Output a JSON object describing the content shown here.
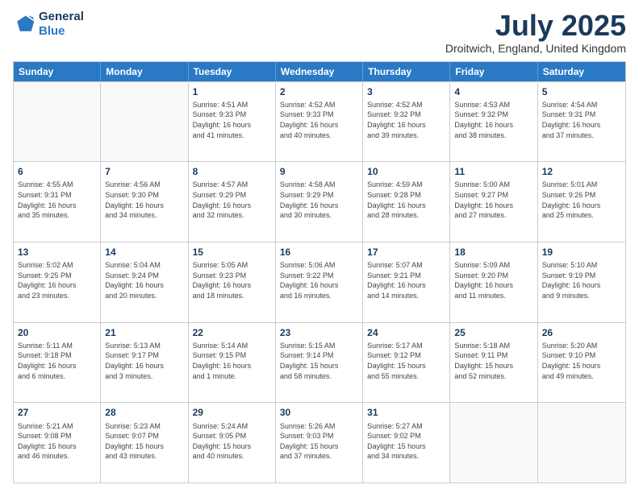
{
  "header": {
    "logo_line1": "General",
    "logo_line2": "Blue",
    "month_title": "July 2025",
    "location": "Droitwich, England, United Kingdom"
  },
  "days_of_week": [
    "Sunday",
    "Monday",
    "Tuesday",
    "Wednesday",
    "Thursday",
    "Friday",
    "Saturday"
  ],
  "weeks": [
    [
      {
        "day": "",
        "info": ""
      },
      {
        "day": "",
        "info": ""
      },
      {
        "day": "1",
        "info": "Sunrise: 4:51 AM\nSunset: 9:33 PM\nDaylight: 16 hours\nand 41 minutes."
      },
      {
        "day": "2",
        "info": "Sunrise: 4:52 AM\nSunset: 9:33 PM\nDaylight: 16 hours\nand 40 minutes."
      },
      {
        "day": "3",
        "info": "Sunrise: 4:52 AM\nSunset: 9:32 PM\nDaylight: 16 hours\nand 39 minutes."
      },
      {
        "day": "4",
        "info": "Sunrise: 4:53 AM\nSunset: 9:32 PM\nDaylight: 16 hours\nand 38 minutes."
      },
      {
        "day": "5",
        "info": "Sunrise: 4:54 AM\nSunset: 9:31 PM\nDaylight: 16 hours\nand 37 minutes."
      }
    ],
    [
      {
        "day": "6",
        "info": "Sunrise: 4:55 AM\nSunset: 9:31 PM\nDaylight: 16 hours\nand 35 minutes."
      },
      {
        "day": "7",
        "info": "Sunrise: 4:56 AM\nSunset: 9:30 PM\nDaylight: 16 hours\nand 34 minutes."
      },
      {
        "day": "8",
        "info": "Sunrise: 4:57 AM\nSunset: 9:29 PM\nDaylight: 16 hours\nand 32 minutes."
      },
      {
        "day": "9",
        "info": "Sunrise: 4:58 AM\nSunset: 9:29 PM\nDaylight: 16 hours\nand 30 minutes."
      },
      {
        "day": "10",
        "info": "Sunrise: 4:59 AM\nSunset: 9:28 PM\nDaylight: 16 hours\nand 28 minutes."
      },
      {
        "day": "11",
        "info": "Sunrise: 5:00 AM\nSunset: 9:27 PM\nDaylight: 16 hours\nand 27 minutes."
      },
      {
        "day": "12",
        "info": "Sunrise: 5:01 AM\nSunset: 9:26 PM\nDaylight: 16 hours\nand 25 minutes."
      }
    ],
    [
      {
        "day": "13",
        "info": "Sunrise: 5:02 AM\nSunset: 9:25 PM\nDaylight: 16 hours\nand 23 minutes."
      },
      {
        "day": "14",
        "info": "Sunrise: 5:04 AM\nSunset: 9:24 PM\nDaylight: 16 hours\nand 20 minutes."
      },
      {
        "day": "15",
        "info": "Sunrise: 5:05 AM\nSunset: 9:23 PM\nDaylight: 16 hours\nand 18 minutes."
      },
      {
        "day": "16",
        "info": "Sunrise: 5:06 AM\nSunset: 9:22 PM\nDaylight: 16 hours\nand 16 minutes."
      },
      {
        "day": "17",
        "info": "Sunrise: 5:07 AM\nSunset: 9:21 PM\nDaylight: 16 hours\nand 14 minutes."
      },
      {
        "day": "18",
        "info": "Sunrise: 5:09 AM\nSunset: 9:20 PM\nDaylight: 16 hours\nand 11 minutes."
      },
      {
        "day": "19",
        "info": "Sunrise: 5:10 AM\nSunset: 9:19 PM\nDaylight: 16 hours\nand 9 minutes."
      }
    ],
    [
      {
        "day": "20",
        "info": "Sunrise: 5:11 AM\nSunset: 9:18 PM\nDaylight: 16 hours\nand 6 minutes."
      },
      {
        "day": "21",
        "info": "Sunrise: 5:13 AM\nSunset: 9:17 PM\nDaylight: 16 hours\nand 3 minutes."
      },
      {
        "day": "22",
        "info": "Sunrise: 5:14 AM\nSunset: 9:15 PM\nDaylight: 16 hours\nand 1 minute."
      },
      {
        "day": "23",
        "info": "Sunrise: 5:15 AM\nSunset: 9:14 PM\nDaylight: 15 hours\nand 58 minutes."
      },
      {
        "day": "24",
        "info": "Sunrise: 5:17 AM\nSunset: 9:12 PM\nDaylight: 15 hours\nand 55 minutes."
      },
      {
        "day": "25",
        "info": "Sunrise: 5:18 AM\nSunset: 9:11 PM\nDaylight: 15 hours\nand 52 minutes."
      },
      {
        "day": "26",
        "info": "Sunrise: 5:20 AM\nSunset: 9:10 PM\nDaylight: 15 hours\nand 49 minutes."
      }
    ],
    [
      {
        "day": "27",
        "info": "Sunrise: 5:21 AM\nSunset: 9:08 PM\nDaylight: 15 hours\nand 46 minutes."
      },
      {
        "day": "28",
        "info": "Sunrise: 5:23 AM\nSunset: 9:07 PM\nDaylight: 15 hours\nand 43 minutes."
      },
      {
        "day": "29",
        "info": "Sunrise: 5:24 AM\nSunset: 9:05 PM\nDaylight: 15 hours\nand 40 minutes."
      },
      {
        "day": "30",
        "info": "Sunrise: 5:26 AM\nSunset: 9:03 PM\nDaylight: 15 hours\nand 37 minutes."
      },
      {
        "day": "31",
        "info": "Sunrise: 5:27 AM\nSunset: 9:02 PM\nDaylight: 15 hours\nand 34 minutes."
      },
      {
        "day": "",
        "info": ""
      },
      {
        "day": "",
        "info": ""
      }
    ]
  ]
}
